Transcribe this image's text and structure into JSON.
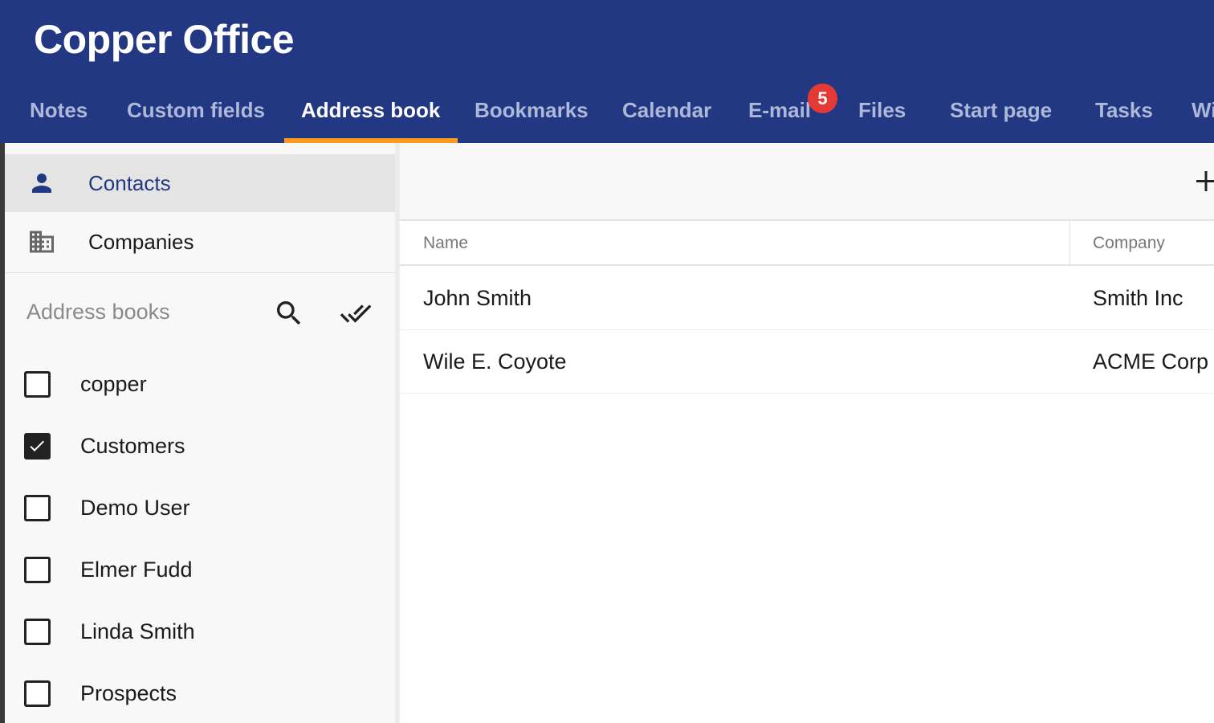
{
  "app": {
    "title": "Copper Office"
  },
  "tabs": [
    {
      "label": "Notes"
    },
    {
      "label": "Custom fields"
    },
    {
      "label": "Address book",
      "active": true
    },
    {
      "label": "Bookmarks"
    },
    {
      "label": "Calendar"
    },
    {
      "label": "E-mail",
      "badge": "5"
    },
    {
      "label": "Files"
    },
    {
      "label": "Start page"
    },
    {
      "label": "Tasks"
    },
    {
      "label": "Wi"
    }
  ],
  "sidebar": {
    "nav": [
      {
        "label": "Contacts",
        "icon": "person-icon",
        "selected": true
      },
      {
        "label": "Companies",
        "icon": "building-icon"
      }
    ],
    "address_books_title": "Address books",
    "books": [
      {
        "label": "copper",
        "checked": false
      },
      {
        "label": "Customers",
        "checked": true
      },
      {
        "label": "Demo User",
        "checked": false
      },
      {
        "label": "Elmer Fudd",
        "checked": false
      },
      {
        "label": "Linda Smith",
        "checked": false
      },
      {
        "label": "Prospects",
        "checked": false
      }
    ]
  },
  "table": {
    "columns": [
      "Name",
      "Company"
    ],
    "rows": [
      {
        "name": "John Smith",
        "company": "Smith Inc"
      },
      {
        "name": "Wile E. Coyote",
        "company": "ACME Corp"
      }
    ]
  },
  "colors": {
    "header": "#233882",
    "active_tab_underline": "#ff9a1f",
    "badge": "#e53935"
  }
}
